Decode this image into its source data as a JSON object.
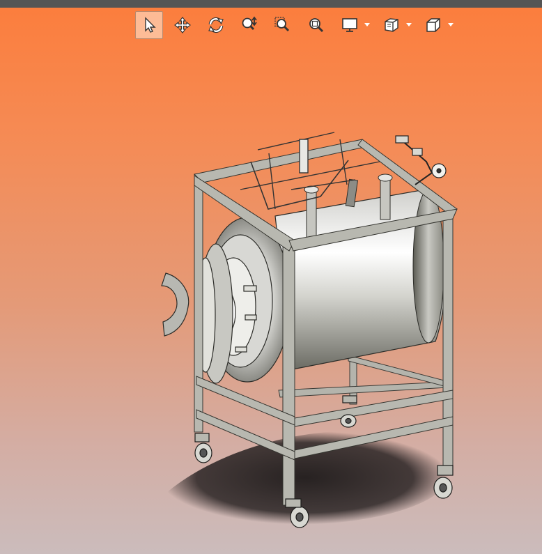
{
  "window": {
    "title_bar_color": "#555555"
  },
  "toolbar": {
    "tools": [
      {
        "id": "select",
        "icon": "select-cursor-icon",
        "active": true
      },
      {
        "id": "pan",
        "icon": "pan-move-icon"
      },
      {
        "id": "rotate",
        "icon": "rotate-icon"
      },
      {
        "id": "zoom-in-out",
        "icon": "zoom-in-out-icon"
      },
      {
        "id": "zoom-window",
        "icon": "zoom-window-icon"
      },
      {
        "id": "zoom-fit",
        "icon": "zoom-fit-icon"
      },
      {
        "id": "display-style",
        "icon": "monitor-display-icon",
        "dropdown": true
      },
      {
        "id": "view-orientation",
        "icon": "view-orientation-icon",
        "dropdown": true
      },
      {
        "id": "standard-views",
        "icon": "cube-view-icon",
        "dropdown": true
      }
    ]
  },
  "viewport": {
    "background_top": "#fc7d3c",
    "background_bottom": "#cbbcbc",
    "model": "stainless-tank-on-wheeled-frame",
    "shading": "realistic-with-edges"
  }
}
